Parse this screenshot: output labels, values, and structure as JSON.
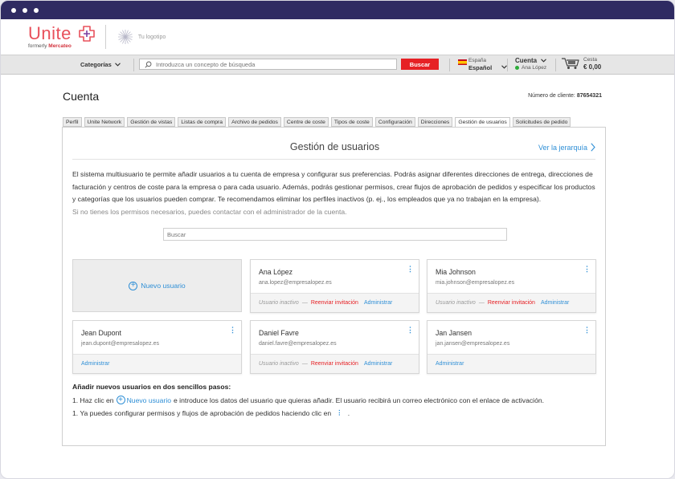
{
  "brand": {
    "name": "Unite",
    "formerly_prefix": "formerly ",
    "formerly_name": "Mercateo",
    "your_logo": "Tu logotipo"
  },
  "nav": {
    "categories": "Categorías",
    "search_placeholder": "Introduzca un concepto de búsqueda",
    "search_button": "Buscar",
    "country": "España",
    "language": "Español",
    "account_label": "Cuenta",
    "account_user": "Ana López",
    "cart_label": "Cesta",
    "cart_total": "€ 0,00"
  },
  "page": {
    "title": "Cuenta",
    "client_label": "Número de cliente:",
    "client_number": "87654321"
  },
  "tabs": [
    {
      "label": "Perfil"
    },
    {
      "label": "Unite Network"
    },
    {
      "label": "Gestión de vistas"
    },
    {
      "label": "Listas de compra"
    },
    {
      "label": "Archivo de pedidos"
    },
    {
      "label": "Centre de coste"
    },
    {
      "label": "Tipos de coste"
    },
    {
      "label": "Configuración"
    },
    {
      "label": "Direcciones"
    },
    {
      "label": "Gestión de usuarios",
      "active": true
    },
    {
      "label": "Solicitudes de pedido"
    }
  ],
  "section": {
    "title": "Gestión de usuarios",
    "hierarchy_link": "Ver la jerarquía",
    "description": "El sistema multiusuario te permite añadir usuarios a tu cuenta de empresa y configurar sus preferencias. Podrás asignar diferentes direcciones de entrega, direcciones de facturación y centros de coste para la empresa o para cada usuario. Además, podrás gestionar permisos, crear flujos de aprobación de pedidos y especificar los productos y categorías que los usuarios pueden comprar. Te recomendamos eliminar los perfiles inactivos (p. ej., los empleados que ya no trabajan en la empresa).",
    "description_muted": "Si no tienes los permisos necesarios, puedes contactar con el administrador de la cuenta.",
    "search_placeholder": "Buscar",
    "new_user": "Nuevo usuario"
  },
  "card_labels": {
    "inactive": "Usuario inactivo",
    "dash": "—",
    "resend": "Reenviar invitación",
    "admin": "Administrar"
  },
  "users": [
    {
      "name": "Ana López",
      "email": "ana.lopez@empresalopez.es",
      "inactive": true
    },
    {
      "name": "Mia Johnson",
      "email": "mia.johnson@empresalopez.es",
      "inactive": true
    },
    {
      "name": "Jean Dupont",
      "email": "jean.dupont@empresalopez.es",
      "inactive": false
    },
    {
      "name": "Daniel Favre",
      "email": "daniel.favre@empresalopez.es",
      "inactive": true
    },
    {
      "name": "Jan Jansen",
      "email": "jan.jansen@empresalopez.es",
      "inactive": false
    }
  ],
  "steps": {
    "title": "Añadir nuevos usuarios en dos sencillos pasos:",
    "step1_prefix": "1. Haz clic en",
    "step1_link": "Nuevo usuario",
    "step1_suffix": "e introduce los datos del usuario que quieras añadir. El usuario recibirá un correo electrónico con el enlace de activación.",
    "step2_prefix": "1. Ya puedes configurar permisos y flujos de aprobación de pedidos haciendo clic en",
    "step2_suffix": "."
  },
  "colors": {
    "titlebar": "#2f2b62",
    "brand": "#e8505b",
    "link": "#2f8fd6",
    "danger": "#e62125"
  }
}
